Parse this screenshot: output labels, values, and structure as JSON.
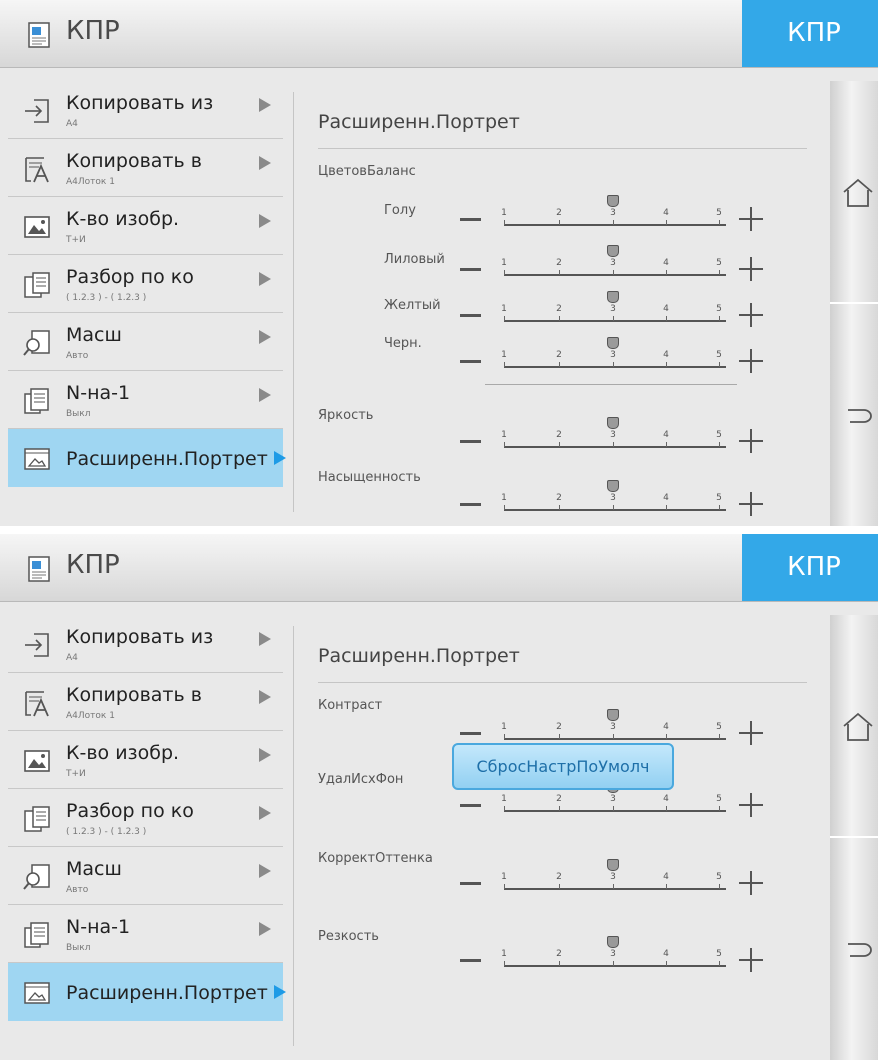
{
  "screens": [
    {
      "header": {
        "title": "КПР",
        "tab_label": "КПР"
      },
      "sidebar": {
        "items": [
          {
            "label": "Копировать из",
            "sub": "A4",
            "icon": "copy-from-icon"
          },
          {
            "label": "Копировать в",
            "sub": "A4Лоток 1",
            "icon": "copy-to-icon"
          },
          {
            "label": "К-во изобр.",
            "sub": "Т+И",
            "icon": "image-icon"
          },
          {
            "label": "Разбор по ко",
            "sub": "( 1.2.3 ) - ( 1.2.3 )",
            "icon": "collate-icon"
          },
          {
            "label": "Масш",
            "sub": "Авто",
            "icon": "zoom-icon"
          },
          {
            "label": "N-на-1",
            "sub": "Выкл",
            "icon": "n-up-icon"
          },
          {
            "label": "Расширенн.Портрет",
            "sub": "",
            "icon": "portrait-icon",
            "selected": true
          }
        ]
      },
      "panel": {
        "title": "Расширенн.Портрет",
        "group_label": "ЦветовБаланс",
        "balance": [
          {
            "label": "Голу",
            "value": 3
          },
          {
            "label": "Лиловый",
            "value": 3
          },
          {
            "label": "Желтый",
            "value": 3
          },
          {
            "label": "Черн.",
            "value": 3
          }
        ],
        "sliders": [
          {
            "label": "Яркость",
            "value": 3
          },
          {
            "label": "Насыщенность",
            "value": 3
          }
        ]
      }
    },
    {
      "header": {
        "title": "КПР",
        "tab_label": "КПР"
      },
      "sidebar": {
        "items": [
          {
            "label": "Копировать из",
            "sub": "A4",
            "icon": "copy-from-icon"
          },
          {
            "label": "Копировать в",
            "sub": "A4Лоток 1",
            "icon": "copy-to-icon"
          },
          {
            "label": "К-во изобр.",
            "sub": "Т+И",
            "icon": "image-icon"
          },
          {
            "label": "Разбор по ко",
            "sub": "( 1.2.3 ) - ( 1.2.3 )",
            "icon": "collate-icon"
          },
          {
            "label": "Масш",
            "sub": "Авто",
            "icon": "zoom-icon"
          },
          {
            "label": "N-на-1",
            "sub": "Выкл",
            "icon": "n-up-icon"
          },
          {
            "label": "Расширенн.Портрет",
            "sub": "",
            "icon": "portrait-icon",
            "selected": true
          }
        ]
      },
      "panel": {
        "title": "Расширенн.Портрет",
        "sliders": [
          {
            "label": "Контраст",
            "value": 3
          },
          {
            "label": "УдалИсхФон",
            "value": 3
          },
          {
            "label": "КорректОттенка",
            "value": 3
          },
          {
            "label": "Резкость",
            "value": 3
          }
        ],
        "reset_label": "СбросНастрПоУмолч"
      }
    }
  ],
  "scale_ticks": [
    "1",
    "2",
    "3",
    "4",
    "5"
  ],
  "colors": {
    "accent": "#33a8e8",
    "selected_bg": "#9fd6f2",
    "panel_bg": "#e9e9e9"
  }
}
